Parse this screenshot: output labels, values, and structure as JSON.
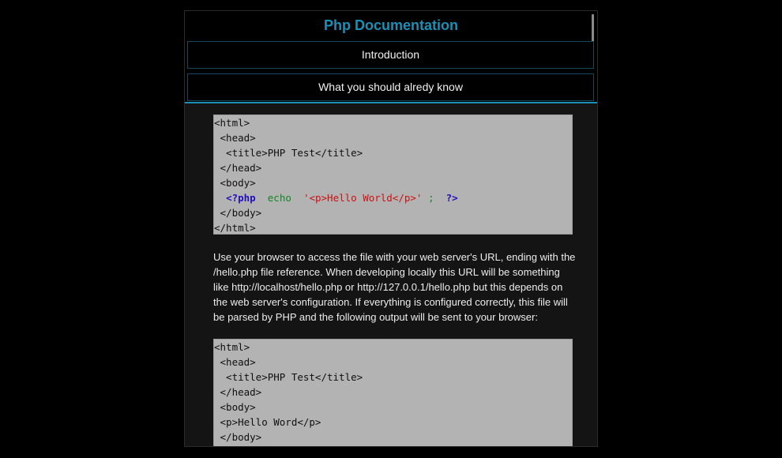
{
  "header": {
    "title": "Php Documentation",
    "nav": [
      {
        "label": "Introduction"
      },
      {
        "label": "What you should alredy know"
      }
    ]
  },
  "code_example_1": {
    "lines": [
      "<html>",
      " <head>",
      "  <title>PHP Test</title>",
      " </head>",
      " <body>"
    ],
    "php_line": {
      "indent": "  ",
      "open_tag": "<?php",
      "keyword": "echo",
      "string": "'<p>Hello World</p>'",
      "semicolon": ";",
      "close_tag": "?>"
    },
    "end_lines": [
      " </body>",
      "</html>"
    ]
  },
  "paragraph": "Use your browser to access the file with your web server's URL, ending with the /hello.php file reference. When developing locally this URL will be something like http://localhost/hello.php or http://127.0.0.1/hello.php but this depends on the web server's configuration. If everything is configured correctly, this file will be parsed by PHP and the following output will be sent to your browser:",
  "code_example_2": {
    "lines": [
      "<html>",
      " <head>",
      "  <title>PHP Test</title>",
      " </head>",
      " <body>",
      " <p>Hello Word</p>",
      " </body>"
    ]
  },
  "colors": {
    "accent": "#1b8fb6",
    "php_tag": "#2211bb",
    "php_keyword": "#118822",
    "php_string": "#cc1111"
  }
}
